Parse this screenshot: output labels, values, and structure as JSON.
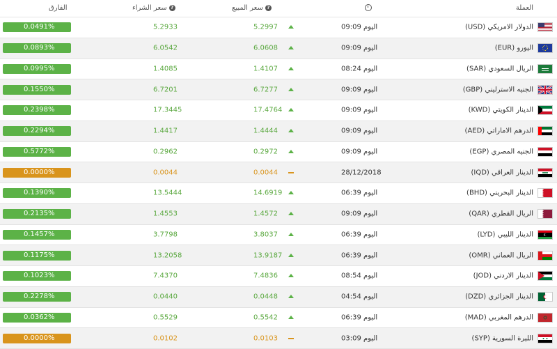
{
  "header": {
    "currency": "العملة",
    "sell": "سعر المبيع",
    "buy": "سعر الشراء",
    "diff": "الفارق"
  },
  "rows": [
    {
      "name": "الدولار الامريكي (USD)",
      "time": "اليوم 09:09",
      "sell": "5.2997",
      "buy": "5.2933",
      "diff": "0.0491%",
      "trend": "up",
      "flag": "us"
    },
    {
      "name": "اليورو (EUR)",
      "time": "اليوم 09:09",
      "sell": "6.0608",
      "buy": "6.0542",
      "diff": "0.0893%",
      "trend": "up",
      "flag": "eu"
    },
    {
      "name": "الريال السعودي (SAR)",
      "time": "اليوم 08:24",
      "sell": "1.4107",
      "buy": "1.4085",
      "diff": "0.0995%",
      "trend": "up",
      "flag": "sa"
    },
    {
      "name": "الجنيه الاسترليني (GBP)",
      "time": "اليوم 09:09",
      "sell": "6.7277",
      "buy": "6.7201",
      "diff": "0.1550%",
      "trend": "up",
      "flag": "gb"
    },
    {
      "name": "الدينار الكويتي (KWD)",
      "time": "اليوم 09:09",
      "sell": "17.4764",
      "buy": "17.3445",
      "diff": "0.2398%",
      "trend": "up",
      "flag": "kw"
    },
    {
      "name": "الدرهم الاماراتي (AED)",
      "time": "اليوم 09:09",
      "sell": "1.4444",
      "buy": "1.4417",
      "diff": "0.2294%",
      "trend": "up",
      "flag": "ae"
    },
    {
      "name": "الجنيه المصري (EGP)",
      "time": "اليوم 09:09",
      "sell": "0.2972",
      "buy": "0.2962",
      "diff": "0.5772%",
      "trend": "up",
      "flag": "eg"
    },
    {
      "name": "الدينار العراقي (IQD)",
      "time": "28/12/2018",
      "sell": "0.0044",
      "buy": "0.0044",
      "diff": "0.0000%",
      "trend": "flat",
      "flag": "iq"
    },
    {
      "name": "الدينار البحريني (BHD)",
      "time": "اليوم 06:39",
      "sell": "14.6919",
      "buy": "13.5444",
      "diff": "0.1390%",
      "trend": "up",
      "flag": "bh"
    },
    {
      "name": "الريال القطري (QAR)",
      "time": "اليوم 09:09",
      "sell": "1.4572",
      "buy": "1.4553",
      "diff": "0.2135%",
      "trend": "up",
      "flag": "qa"
    },
    {
      "name": "الدينار الليبي (LYD)",
      "time": "اليوم 06:39",
      "sell": "3.8037",
      "buy": "3.7798",
      "diff": "0.1457%",
      "trend": "up",
      "flag": "ly"
    },
    {
      "name": "الريال العماني (OMR)",
      "time": "اليوم 06:39",
      "sell": "13.9187",
      "buy": "13.2058",
      "diff": "0.1175%",
      "trend": "up",
      "flag": "om"
    },
    {
      "name": "الدينار الاردني (JOD)",
      "time": "اليوم 08:54",
      "sell": "7.4836",
      "buy": "7.4370",
      "diff": "0.1023%",
      "trend": "up",
      "flag": "jo"
    },
    {
      "name": "الدينار الجزائري (DZD)",
      "time": "اليوم 04:54",
      "sell": "0.0448",
      "buy": "0.0440",
      "diff": "0.2278%",
      "trend": "up",
      "flag": "dz"
    },
    {
      "name": "الدرهم المغربي (MAD)",
      "time": "اليوم 06:39",
      "sell": "0.5542",
      "buy": "0.5529",
      "diff": "0.0362%",
      "trend": "up",
      "flag": "ma"
    },
    {
      "name": "الليرة السورية (SYP)",
      "time": "اليوم 03:09",
      "sell": "0.0103",
      "buy": "0.0102",
      "diff": "0.0000%",
      "trend": "flat",
      "flag": "sy"
    }
  ],
  "colors": {
    "up": "#5cb247",
    "flat": "#d9941c"
  }
}
